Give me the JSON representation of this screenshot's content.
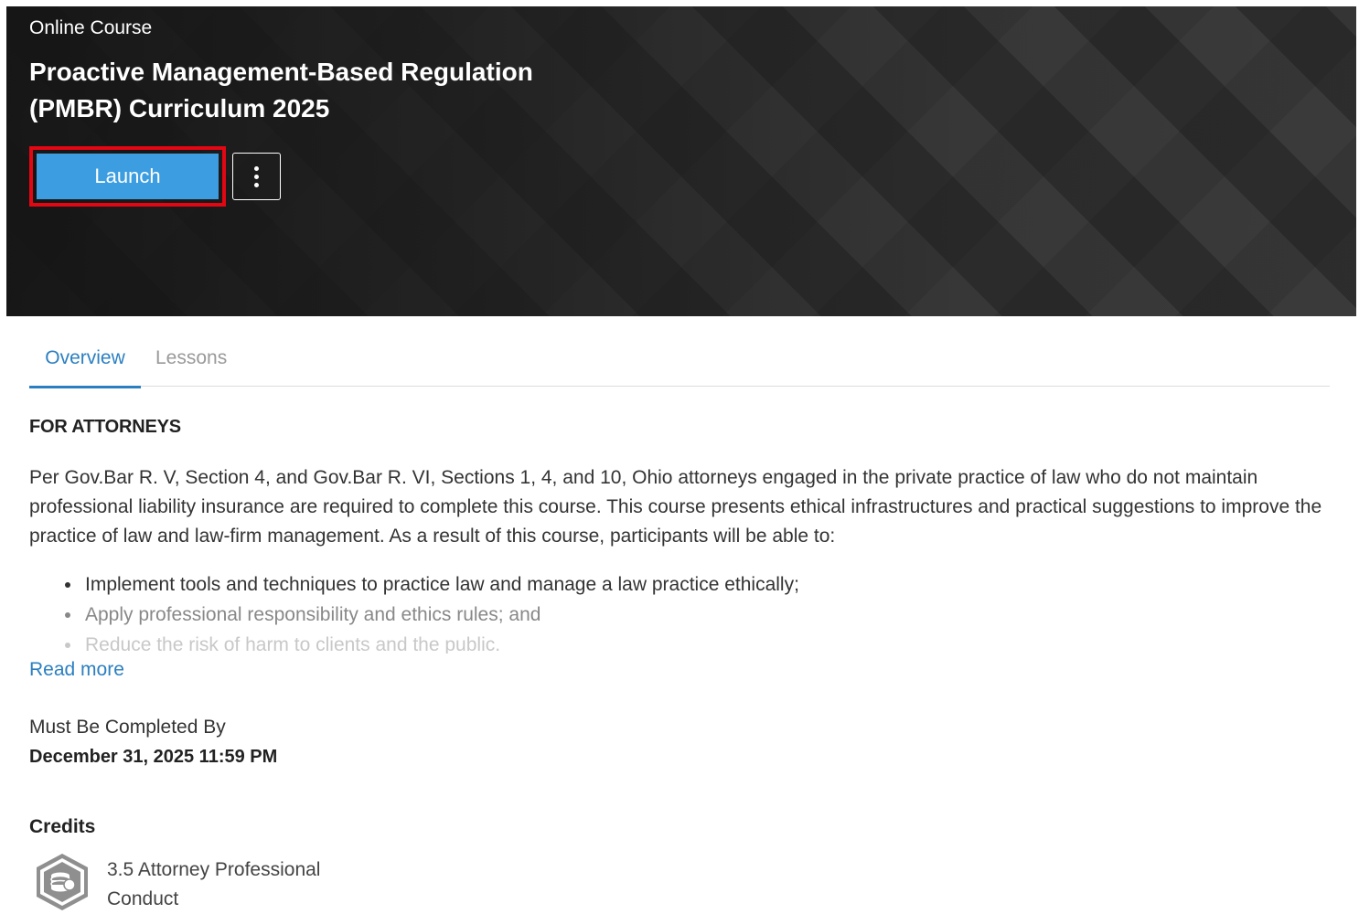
{
  "hero": {
    "type_label": "Online Course",
    "title": "Proactive Management-Based Regulation (PMBR) Curriculum 2025",
    "launch_label": "Launch",
    "more_icon": "vertical-ellipsis-icon"
  },
  "tabs": [
    {
      "label": "Overview",
      "active": true
    },
    {
      "label": "Lessons",
      "active": false
    }
  ],
  "overview": {
    "heading": "FOR ATTORNEYS",
    "description": "Per Gov.Bar R. V, Section 4, and Gov.Bar R. VI, Sections 1, 4, and 10, Ohio attorneys engaged in the private practice of law who do not maintain professional liability insurance are required to complete this course. This course presents ethical infrastructures and practical suggestions to improve the practice of law and law-firm management. As a result of this course, participants will be able to:",
    "bullets": [
      "Implement tools and techniques to practice law and manage a law practice ethically;",
      "Apply professional responsibility and ethics rules; and",
      "Reduce the risk of harm to clients and the public."
    ],
    "read_more": "Read more"
  },
  "due": {
    "label": "Must Be Completed By",
    "value": "December 31, 2025 11:59 PM"
  },
  "credits": {
    "heading": "Credits",
    "items": [
      {
        "text": "3.5 Attorney Professional Conduct",
        "icon": "credit-coins-icon"
      }
    ]
  },
  "colors": {
    "accent": "#2b7fc1",
    "launch_button": "#3c9de0",
    "highlight_border": "#e30613"
  }
}
